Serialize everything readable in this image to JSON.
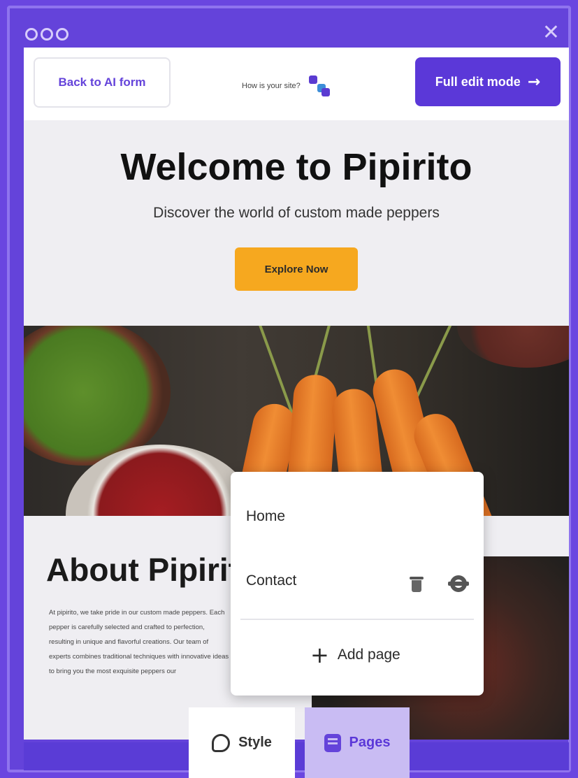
{
  "window": {
    "close_glyph": "✕"
  },
  "toolbar": {
    "back_label": "Back to AI form",
    "rating_prompt": "How is your site?",
    "full_edit_label": "Full edit mode",
    "full_edit_arrow": "→"
  },
  "hero": {
    "title": "Welcome to Pipirito",
    "subtitle": "Discover the world of custom made peppers",
    "cta_label": "Explore Now"
  },
  "about": {
    "title": "About Pipirito",
    "body": "At pipirito, we take pride in our custom made peppers. Each pepper is carefully selected and crafted to perfection, resulting in unique and flavorful creations. Our team of experts combines traditional techniques with innovative ideas to bring you the most exquisite peppers our"
  },
  "pages_popup": {
    "pages": [
      "Home",
      "Contact"
    ],
    "add_label": "Add page",
    "add_glyph": "+"
  },
  "tabs": {
    "style_label": "Style",
    "pages_label": "Pages"
  },
  "colors": {
    "frame": "#6a46e0",
    "brand": "#5b38d8",
    "cta": "#f6a81f",
    "active_tab": "#c9bcf3"
  },
  "icons": [
    "window-dots-icon",
    "close-icon",
    "rating-icon",
    "arrow-right-icon",
    "trash-icon",
    "gear-icon",
    "plus-icon",
    "palette-icon",
    "pages-icon"
  ]
}
